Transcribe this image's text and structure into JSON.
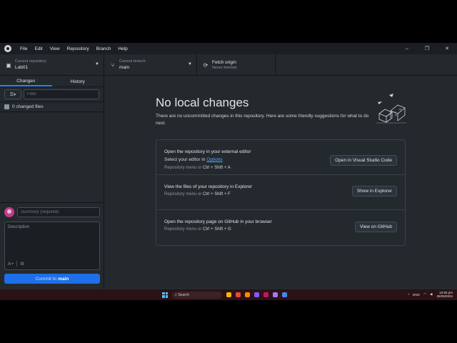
{
  "menubar": {
    "items": [
      "File",
      "Edit",
      "View",
      "Repository",
      "Branch",
      "Help"
    ],
    "controls": [
      "–",
      "❐",
      "✕"
    ]
  },
  "toolbar": {
    "repo_label": "Current repository",
    "repo_value": "Lab01",
    "branch_label": "Current branch",
    "branch_value": "main",
    "fetch_label": "Fetch origin",
    "fetch_sub": "Never fetched"
  },
  "sidebar": {
    "tabs": [
      "Changes",
      "History"
    ],
    "filter_placeholder": "Filter",
    "changed_files": "0 changed files",
    "summary_placeholder": "Summary (required)",
    "description_placeholder": "Description",
    "commit_prefix": "Commit to",
    "commit_branch": "main"
  },
  "main": {
    "title": "No local changes",
    "description": "There are no uncommitted changes in this repository. Here are some friendly suggestions for what to do next.",
    "cards": [
      {
        "title": "Open the repository in your external editor",
        "sub_prefix": "Select your editor in ",
        "sub_link": "Options",
        "hint_prefix": "Repository menu or ",
        "keys": "Ctrl + Shift + A",
        "button": "Open in Visual Studio Code"
      },
      {
        "title": "View the files of your repository in Explorer",
        "hint_prefix": "Repository menu or ",
        "keys": "Ctrl + Shift + F",
        "button": "Show in Explorer"
      },
      {
        "title": "Open the repository page on GitHub in your browser",
        "hint_prefix": "Repository menu or ",
        "keys": "Ctrl + Shift + G",
        "button": "View on GitHub"
      }
    ]
  },
  "taskbar": {
    "search": "Search",
    "lang": "ENG",
    "time": "10:55 pm",
    "date": "26/06/2024",
    "app_colors": [
      "#f4b400",
      "#e8453c",
      "#ff8a00",
      "#7b5cff",
      "#c2185b",
      "#9e7bff",
      "#4285f4"
    ]
  },
  "colors": {
    "accent": "#1f6feb",
    "link": "#58a6ff",
    "background": "#24292e"
  }
}
